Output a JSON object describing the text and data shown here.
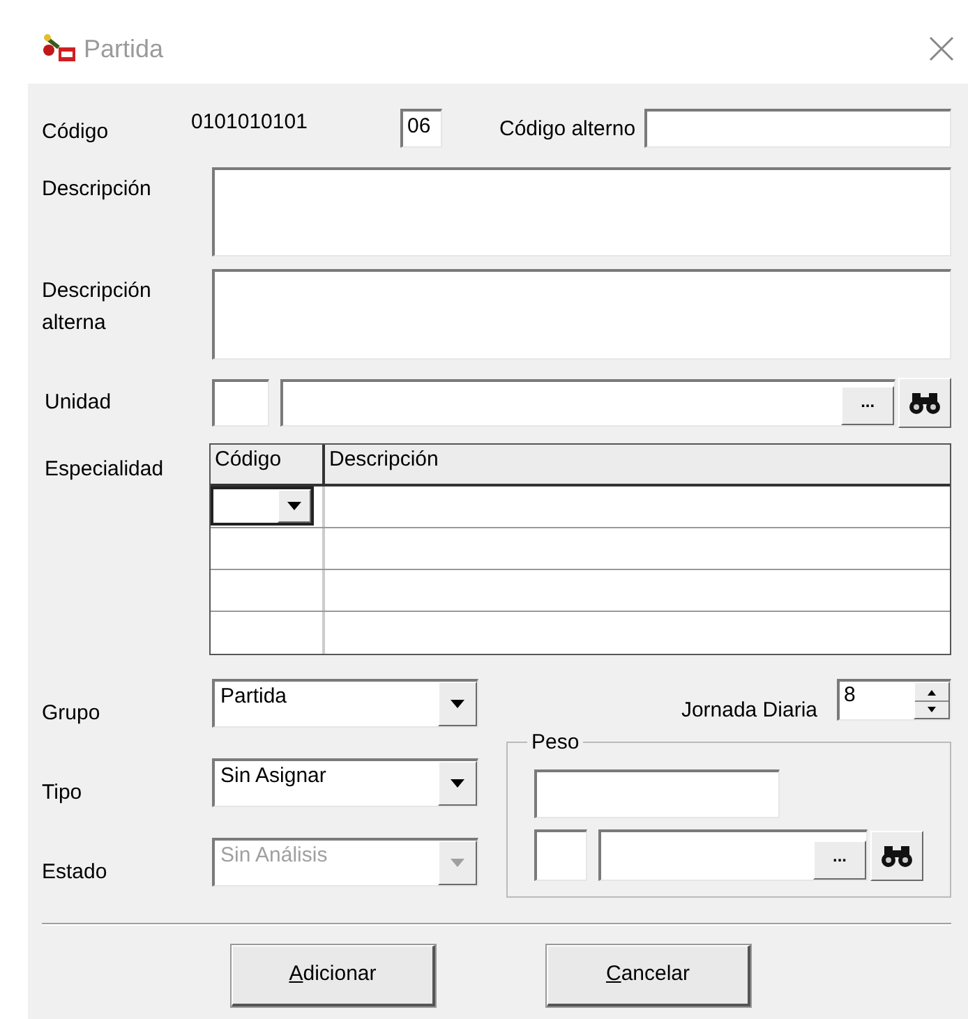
{
  "window": {
    "title": "Partida"
  },
  "codigo": {
    "label": "Código",
    "value": "0101010101",
    "suffix_value": "06"
  },
  "codigo_alterno": {
    "label": "Código alterno"
  },
  "descripcion": {
    "label": "Descripción"
  },
  "descripcion_alterna": {
    "label": "Descripción alterna"
  },
  "unidad": {
    "label": "Unidad",
    "browse_label": "..."
  },
  "especialidad": {
    "label": "Especialidad",
    "columns": [
      "Código",
      "Descripción"
    ],
    "rows": [
      {
        "kind": "dropdown"
      },
      {
        "kind": "blank"
      },
      {
        "kind": "blank"
      },
      {
        "kind": "blank"
      }
    ]
  },
  "combos": [
    {
      "label": "Grupo",
      "value": "Partida",
      "disabled": false
    },
    {
      "label": "Tipo",
      "value": "Sin Asignar",
      "disabled": false
    },
    {
      "label": "Estado",
      "value": "Sin Análisis",
      "disabled": true
    }
  ],
  "jornada_diaria": {
    "label": "Jornada Diaria",
    "value": "8"
  },
  "peso": {
    "legend": "Peso",
    "browse_label": "..."
  },
  "buttons": [
    {
      "label": "Adicionar",
      "underline_first": true
    },
    {
      "label": "Cancelar",
      "underline_first": true
    }
  ]
}
